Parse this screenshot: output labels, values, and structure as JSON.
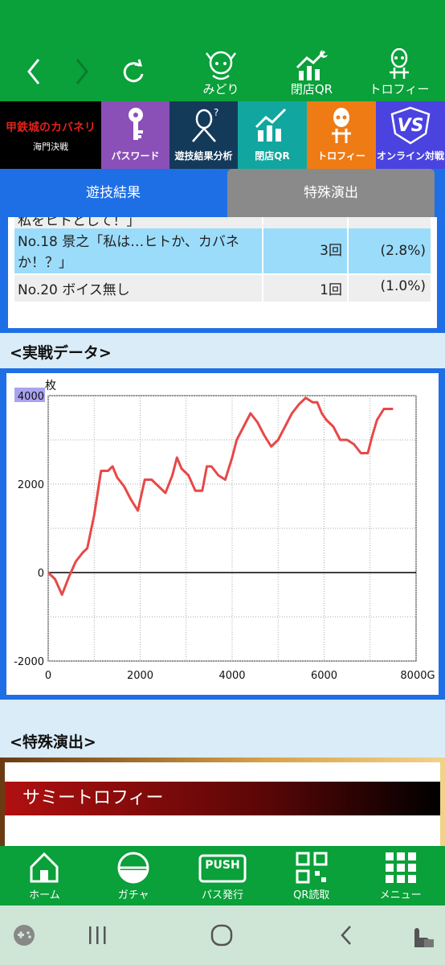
{
  "header": {
    "icons": [
      {
        "name": "midori",
        "label": "みどり"
      },
      {
        "name": "close-qr",
        "label": "閉店QR"
      },
      {
        "name": "trophy",
        "label": "トロフィー"
      }
    ]
  },
  "tiles": [
    {
      "label": "",
      "logo_text": "甲鉄城のカバネリ",
      "logo_sub": "海門決戦"
    },
    {
      "label": "パスワード"
    },
    {
      "label": "遊技結果分析"
    },
    {
      "label": "閉店QR"
    },
    {
      "label": "トロフィー"
    },
    {
      "label": "オンライン対戦",
      "vs_text": "VS"
    }
  ],
  "tabs": {
    "active": "遊技結果",
    "inactive": "特殊演出"
  },
  "results": {
    "rows": [
      {
        "name": "私をヒトとして！」",
        "count": "",
        "rate": ""
      },
      {
        "name": "No.18 景之「私は…ヒトか、カバネか！？」",
        "count": "3回",
        "rate": "(2.8%)"
      },
      {
        "name": "No.20 ボイス無し",
        "count": "1回",
        "rate": "(1.0%)"
      }
    ]
  },
  "sections": {
    "chart_heading": "<実戦データ>",
    "special_heading": "<特殊演出>"
  },
  "special": {
    "trophy_title": "サミートロフィー"
  },
  "chart_data": {
    "type": "line",
    "ylabel": "枚",
    "xlabel": "",
    "xlim": [
      0,
      8000
    ],
    "ylim": [
      -2000,
      4000
    ],
    "x_ticks": [
      "0",
      "2000",
      "4000",
      "6000",
      "8000G"
    ],
    "y_ticks": [
      "4000",
      "2000",
      "0",
      "-2000"
    ],
    "grid": true,
    "series": [
      {
        "color": "#e84848",
        "x": [
          0,
          150,
          300,
          450,
          600,
          750,
          850,
          1000,
          1150,
          1300,
          1400,
          1500,
          1650,
          1800,
          1950,
          2100,
          2250,
          2400,
          2550,
          2700,
          2800,
          2900,
          3050,
          3200,
          3350,
          3450,
          3550,
          3700,
          3850,
          4000,
          4100,
          4250,
          4400,
          4550,
          4700,
          4850,
          5000,
          5150,
          5300,
          5450,
          5600,
          5750,
          5850,
          5950,
          6050,
          6200,
          6350,
          6500,
          6650,
          6800,
          6950,
          7050,
          7150,
          7300,
          7400,
          7500
        ],
        "y": [
          0,
          -150,
          -500,
          -100,
          250,
          450,
          550,
          1300,
          2300,
          2300,
          2400,
          2150,
          1950,
          1650,
          1400,
          2100,
          2100,
          1950,
          1800,
          2200,
          2600,
          2350,
          2200,
          1850,
          1850,
          2400,
          2400,
          2200,
          2100,
          2600,
          3000,
          3300,
          3600,
          3400,
          3100,
          2850,
          3000,
          3300,
          3600,
          3800,
          3950,
          3850,
          3850,
          3600,
          3450,
          3300,
          3000,
          3000,
          2900,
          2700,
          2700,
          3100,
          3450,
          3700,
          3700,
          3700
        ]
      }
    ]
  },
  "bottom_nav": [
    {
      "label": "ホーム"
    },
    {
      "label": "ガチャ"
    },
    {
      "label": "パス発行",
      "badge": "PUSH"
    },
    {
      "label": "QR読取"
    },
    {
      "label": "メニュー"
    }
  ]
}
